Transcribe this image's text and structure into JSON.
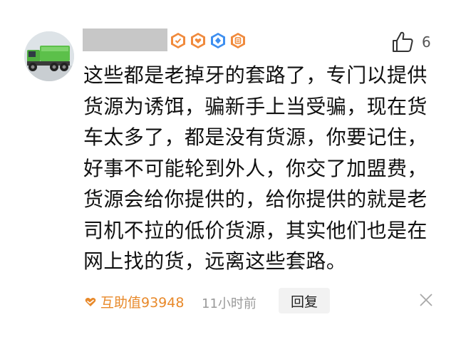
{
  "comment": {
    "avatar_icon": "green-dump-truck-toy-avatar",
    "badges": [
      {
        "icon": "check-badge-icon",
        "color": "#f08a3c"
      },
      {
        "icon": "heart-badge-icon",
        "color": "#f08a3c"
      },
      {
        "icon": "diamond-badge-icon",
        "color": "#3d8ff0"
      },
      {
        "icon": "doc-badge-icon",
        "color": "#f08a3c"
      }
    ],
    "like_icon": "thumbs-up-icon",
    "like_count": "6",
    "lines": [
      "这些都是老掉牙的套路了，专门以提供",
      "货源为诱饵，骗新手上当受骗，现在货",
      "车太多了，都是没有货源，你要记住，",
      "好事不可能轮到外人，你交了加盟费，",
      "货源会给你提供的，给你提供的就是老",
      "司机不拉的低价货源，其实他们也是在",
      "网上找的货，远离这些套路。"
    ],
    "helpful_icon": "heart-hand-icon",
    "helpful_value": "互助值93948",
    "time": "11小时前",
    "reply_label": "回复",
    "close_icon": "close-icon"
  },
  "colors": {
    "accent": "#e8892a",
    "badge_blue": "#3d8ff0",
    "muted": "#9a9a9a"
  }
}
